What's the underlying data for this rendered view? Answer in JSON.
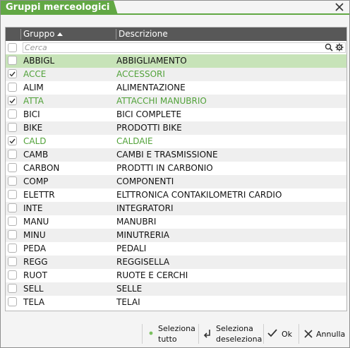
{
  "window": {
    "title": "Gruppi merceologici"
  },
  "grid": {
    "columns": {
      "gruppo": "Gruppo",
      "descrizione": "Descrizione"
    },
    "search_placeholder": "Cerca",
    "rows": [
      {
        "code": "ABBIGL",
        "desc": "ABBIGLIAMENTO",
        "checked": false
      },
      {
        "code": "ACCE",
        "desc": "ACCESSORI",
        "checked": true
      },
      {
        "code": "ALIM",
        "desc": "ALIMENTAZIONE",
        "checked": false
      },
      {
        "code": "ATTA",
        "desc": "ATTACCHI MANUBRIO",
        "checked": true
      },
      {
        "code": "BICI",
        "desc": "BICI COMPLETE",
        "checked": false
      },
      {
        "code": "BIKE",
        "desc": "PRODOTTI BIKE",
        "checked": false
      },
      {
        "code": "CALD",
        "desc": "CALDAIE",
        "checked": true
      },
      {
        "code": "CAMB",
        "desc": "CAMBI E TRASMISSIONE",
        "checked": false
      },
      {
        "code": "CARBON",
        "desc": "PRODTTI IN CARBONIO",
        "checked": false
      },
      {
        "code": "COMP",
        "desc": "COMPONENTI",
        "checked": false
      },
      {
        "code": "ELETTR",
        "desc": "ELTTRONICA CONTAKILOMETRI CARDIO",
        "checked": false
      },
      {
        "code": "INTE",
        "desc": "INTEGRATORI",
        "checked": false
      },
      {
        "code": "MANU",
        "desc": "MANUBRI",
        "checked": false
      },
      {
        "code": "MINU",
        "desc": "MINUTRERIA",
        "checked": false
      },
      {
        "code": "PEDA",
        "desc": "PEDALI",
        "checked": false
      },
      {
        "code": "REGG",
        "desc": "REGGISELLA",
        "checked": false
      },
      {
        "code": "RUOT",
        "desc": "RUOTE E CERCHI",
        "checked": false
      },
      {
        "code": "SELL",
        "desc": "SELLE",
        "checked": false
      },
      {
        "code": "TELA",
        "desc": "TELAI",
        "checked": false
      }
    ]
  },
  "footer": {
    "seleziona_tutto": [
      "Seleziona",
      "tutto"
    ],
    "seleziona_deseleziona": [
      "Seleziona",
      "deseleziona"
    ],
    "ok": "Ok",
    "annulla": "Annulla"
  },
  "colors": {
    "accent": "#62a844",
    "selected_text": "#52a23a",
    "highlight_row": "#c7e3b8",
    "header_bg": "#585858"
  }
}
